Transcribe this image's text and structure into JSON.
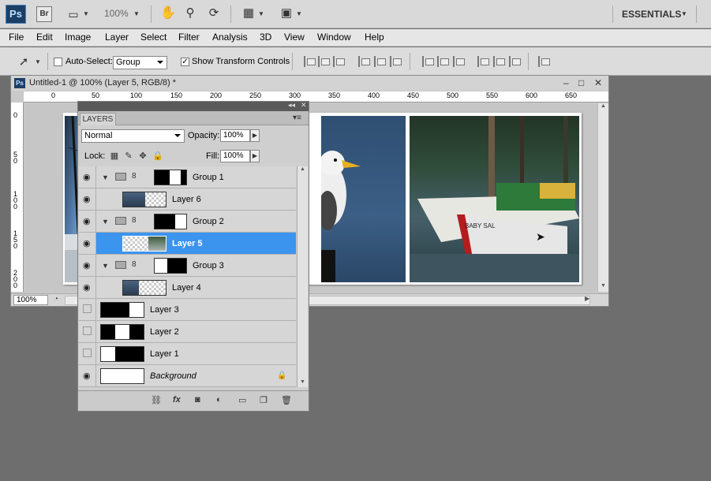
{
  "app": {
    "logo": "Ps",
    "bridge_logo": "Br",
    "zoom": "100%",
    "workspace": "ESSENTIALS"
  },
  "menu": [
    "File",
    "Edit",
    "Image",
    "Layer",
    "Select",
    "Filter",
    "Analysis",
    "3D",
    "View",
    "Window",
    "Help"
  ],
  "options": {
    "auto_select_label": "Auto-Select:",
    "auto_select_value": "Group",
    "show_transform_label": "Show Transform Controls",
    "auto_select_checked": false,
    "show_transform_checked": true
  },
  "document": {
    "title": "Untitled-1 @ 100% (Layer 5, RGB/8) *",
    "zoom": "100%",
    "ruler_h": [
      "0",
      "50",
      "100",
      "150",
      "200",
      "250",
      "300",
      "350",
      "400",
      "450",
      "500",
      "550",
      "600",
      "650"
    ],
    "ruler_v": [
      "0",
      "5 0",
      "1 0 0",
      "1 5 0",
      "2 0 0"
    ]
  },
  "layers_panel": {
    "tab": "LAYERS",
    "blend_mode": "Normal",
    "opacity_label": "Opacity:",
    "opacity": "100%",
    "lock_label": "Lock:",
    "fill_label": "Fill:",
    "fill": "100%",
    "layers": [
      {
        "name": "Group 1",
        "type": "group",
        "visible": true
      },
      {
        "name": "Layer 6",
        "type": "layer",
        "visible": true
      },
      {
        "name": "Group 2",
        "type": "group",
        "visible": true
      },
      {
        "name": "Layer 5",
        "type": "layer",
        "visible": true,
        "selected": true
      },
      {
        "name": "Group 3",
        "type": "group",
        "visible": true
      },
      {
        "name": "Layer 4",
        "type": "layer",
        "visible": true
      },
      {
        "name": "Layer 3",
        "type": "mask",
        "visible": false
      },
      {
        "name": "Layer 2",
        "type": "mask",
        "visible": false
      },
      {
        "name": "Layer 1",
        "type": "mask",
        "visible": false
      },
      {
        "name": "Background",
        "type": "background",
        "visible": true,
        "locked": true
      }
    ]
  },
  "colors": {
    "selection": "#3b94ee",
    "app_bg": "#6e6e6e"
  }
}
